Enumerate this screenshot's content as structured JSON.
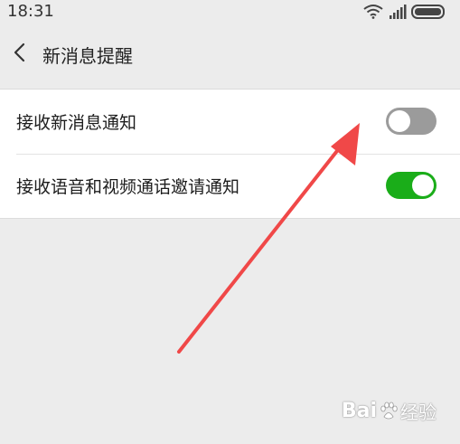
{
  "status_bar": {
    "time": "18:31",
    "icons": [
      "wifi-icon",
      "signal-icon",
      "battery-icon"
    ]
  },
  "header": {
    "back_icon": "chevron-left-icon",
    "title": "新消息提醒"
  },
  "settings": {
    "items": [
      {
        "label": "接收新消息通知",
        "toggle_state": "off"
      },
      {
        "label": "接收语音和视频通话邀请通知",
        "toggle_state": "on"
      }
    ]
  },
  "annotation": {
    "arrow_color": "#f04848"
  },
  "watermark": {
    "text_bai": "Bai",
    "text_jingyan": "经验"
  },
  "colors": {
    "toggle_on": "#1aad19",
    "toggle_off": "#9b9b9b",
    "background": "#ececec"
  }
}
